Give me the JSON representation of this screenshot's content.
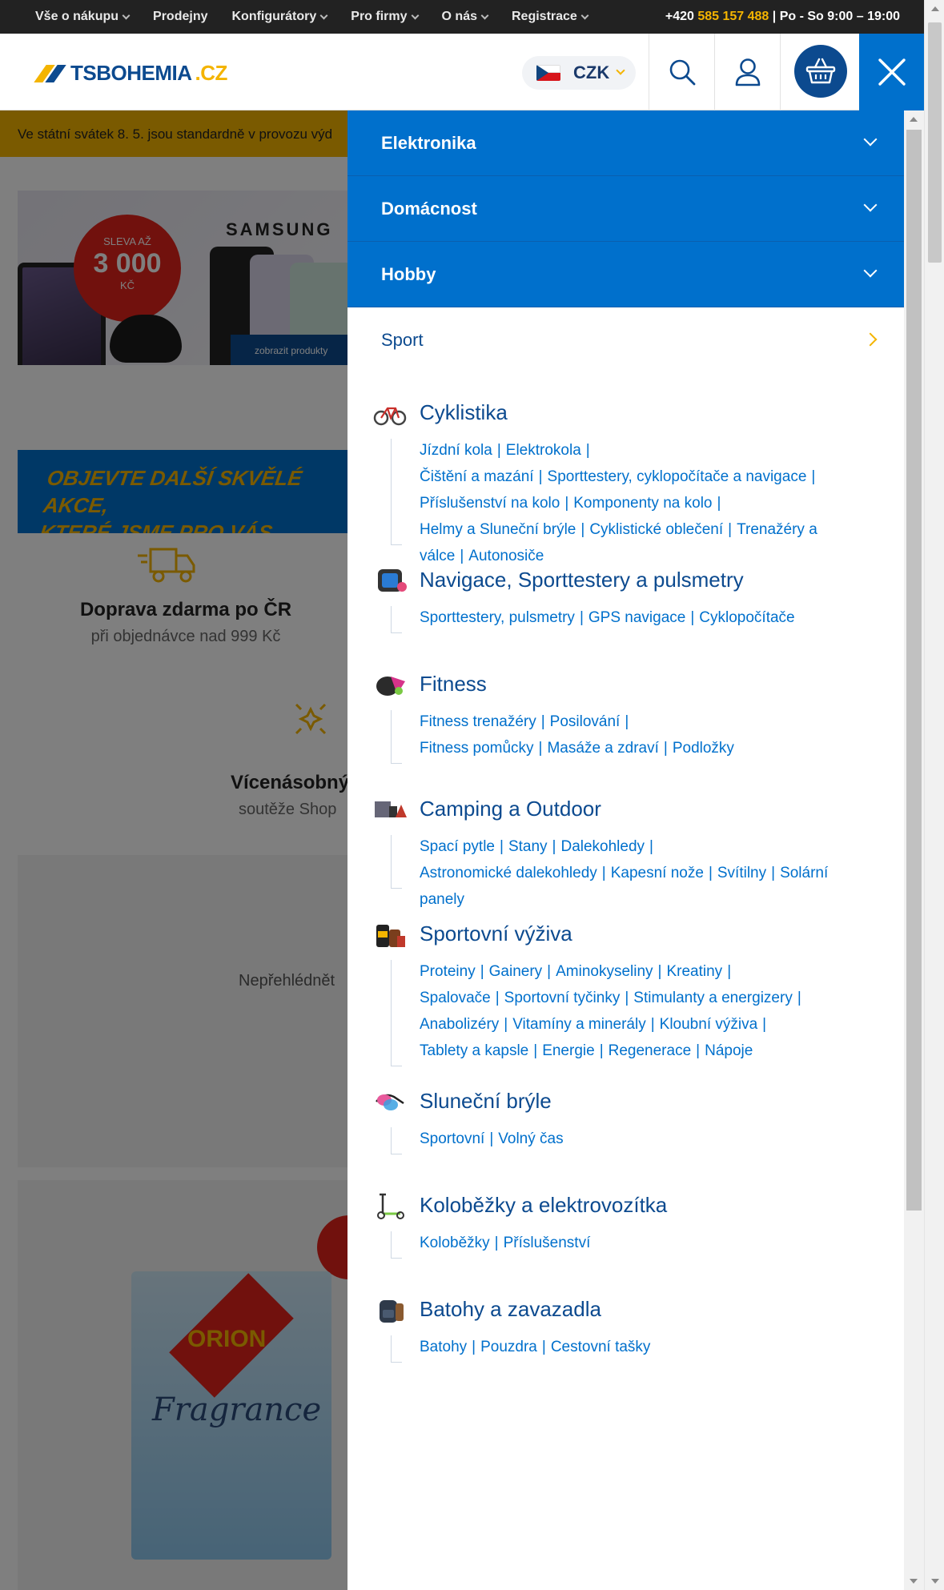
{
  "topnav": {
    "items": [
      "Vše o nákupu",
      "Prodejny",
      "Konfigurátory",
      "Pro firmy",
      "O nás",
      "Registrace"
    ],
    "phone_prefix": "+420",
    "phone_number": "585 157 488",
    "hours": "| Po - So 9:00 – 19:00"
  },
  "header": {
    "logo_main": "TSBOHEMIA",
    "logo_tld": ".CZ",
    "currency": "CZK"
  },
  "background": {
    "holiday_notice": "Ve státní svátek 8. 5. jsou standardně v provozu výd",
    "banner_sale_small": "SLEVA AŽ",
    "banner_sale_big": "3 000",
    "banner_sale_unit": "KČ",
    "banner_brand": "SAMSUNG",
    "banner_button": "zobrazit produkty",
    "promo_line1": "OBJEVTE DALŠÍ SKVĚLÉ AKCE,",
    "promo_line2": "KTERÉ JSME PRO VÁS PŘIPRAVILI",
    "feature1_title": "Doprava zdarma po ČR",
    "feature1_sub": "při objednávce nad 999 Kč",
    "feature2_title": "Vícenásobný",
    "feature2_sub": "soutěže Shop",
    "card1_sub": "Nepřehlédnět",
    "product_brand": "ORION",
    "product_name": "Fragrance"
  },
  "menu": {
    "categories": [
      "Elektronika",
      "Domácnost",
      "Hobby"
    ],
    "open_category": "Sport",
    "groups": [
      {
        "title": "Cyklistika",
        "icon": "bicycle-icon",
        "links": [
          "Jízdní kola",
          "Elektrokola",
          "Čištění a mazání",
          "Sporttestery, cyklopočítače a navigace",
          "Příslušenství na kolo",
          "Komponenty na kolo",
          "Helmy a Sluneční brýle",
          "Cyklistické oblečení",
          "Trenažéry a válce",
          "Autonosiče"
        ]
      },
      {
        "title": "Navigace, Sporttestery a pulsmetry",
        "icon": "smartwatch-icon",
        "links": [
          "Sporttestery, pulsmetry",
          "GPS navigace",
          "Cyklopočítače"
        ]
      },
      {
        "title": "Fitness",
        "icon": "fitness-icon",
        "links": [
          "Fitness trenažéry",
          "Posilování",
          "Fitness pomůcky",
          "Masáže a zdraví",
          "Podložky"
        ]
      },
      {
        "title": "Camping a Outdoor",
        "icon": "camping-icon",
        "links": [
          "Spací pytle",
          "Stany",
          "Dalekohledy",
          "Astronomické dalekohledy",
          "Kapesní nože",
          "Svítilny",
          "Solární panely"
        ]
      },
      {
        "title": "Sportovní výživa",
        "icon": "supplements-icon",
        "links": [
          "Proteiny",
          "Gainery",
          "Aminokyseliny",
          "Kreatiny",
          "Spalovače",
          "Sportovní tyčinky",
          "Stimulanty a energizery",
          "Anabolizéry",
          "Vitamíny a minerály",
          "Kloubní výživa",
          "Tablety a kapsle",
          "Energie",
          "Regenerace",
          "Nápoje"
        ]
      },
      {
        "title": "Sluneční brýle",
        "icon": "sunglasses-icon",
        "links": [
          "Sportovní",
          "Volný čas"
        ]
      },
      {
        "title": "Koloběžky a elektrovozítka",
        "icon": "scooter-icon",
        "links": [
          "Koloběžky",
          "Příslušenství"
        ]
      },
      {
        "title": "Batohy a zavazadla",
        "icon": "backpack-icon",
        "links": [
          "Batohy",
          "Pouzdra",
          "Cestovní tašky"
        ]
      }
    ]
  },
  "colors": {
    "primary_blue": "#0070cc",
    "dark_blue": "#0c4a8f",
    "accent_yellow": "#f4b400",
    "topbar_bg": "#222222"
  }
}
